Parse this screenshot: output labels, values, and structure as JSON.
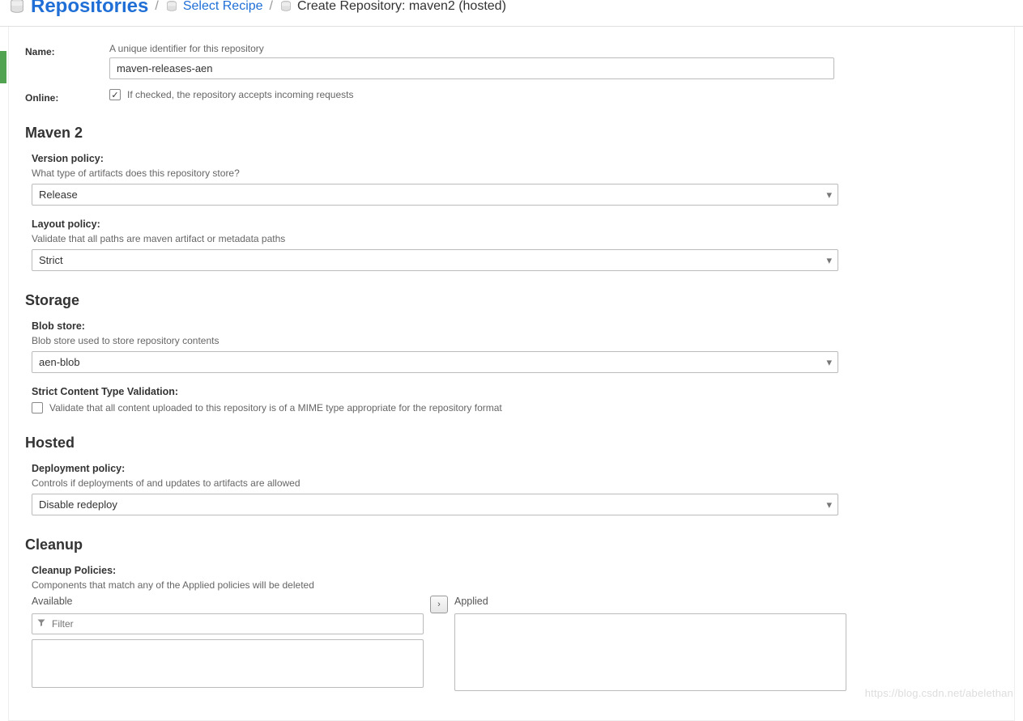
{
  "breadcrumb": {
    "root": "Repositories",
    "select": "Select Recipe",
    "current": "Create Repository: maven2 (hosted)"
  },
  "name_field": {
    "label": "Name:",
    "help": "A unique identifier for this repository",
    "value": "maven-releases-aen"
  },
  "online_field": {
    "label": "Online:",
    "checked": true,
    "help": "If checked, the repository accepts incoming requests"
  },
  "maven2": {
    "title": "Maven 2",
    "version_policy": {
      "label": "Version policy:",
      "help": "What type of artifacts does this repository store?",
      "value": "Release"
    },
    "layout_policy": {
      "label": "Layout policy:",
      "help": "Validate that all paths are maven artifact or metadata paths",
      "value": "Strict"
    }
  },
  "storage": {
    "title": "Storage",
    "blob_store": {
      "label": "Blob store:",
      "help": "Blob store used to store repository contents",
      "value": "aen-blob"
    },
    "strict_validation": {
      "label": "Strict Content Type Validation:",
      "check_label": "Validate that all content uploaded to this repository is of a MIME type appropriate for the repository format",
      "checked": false
    }
  },
  "hosted": {
    "title": "Hosted",
    "deployment_policy": {
      "label": "Deployment policy:",
      "help": "Controls if deployments of and updates to artifacts are allowed",
      "value": "Disable redeploy"
    }
  },
  "cleanup": {
    "title": "Cleanup",
    "policies": {
      "label": "Cleanup Policies:",
      "help": "Components that match any of the Applied policies will be deleted",
      "available_label": "Available",
      "applied_label": "Applied",
      "filter_placeholder": "Filter"
    }
  },
  "watermark": "https://blog.csdn.net/abelethan"
}
